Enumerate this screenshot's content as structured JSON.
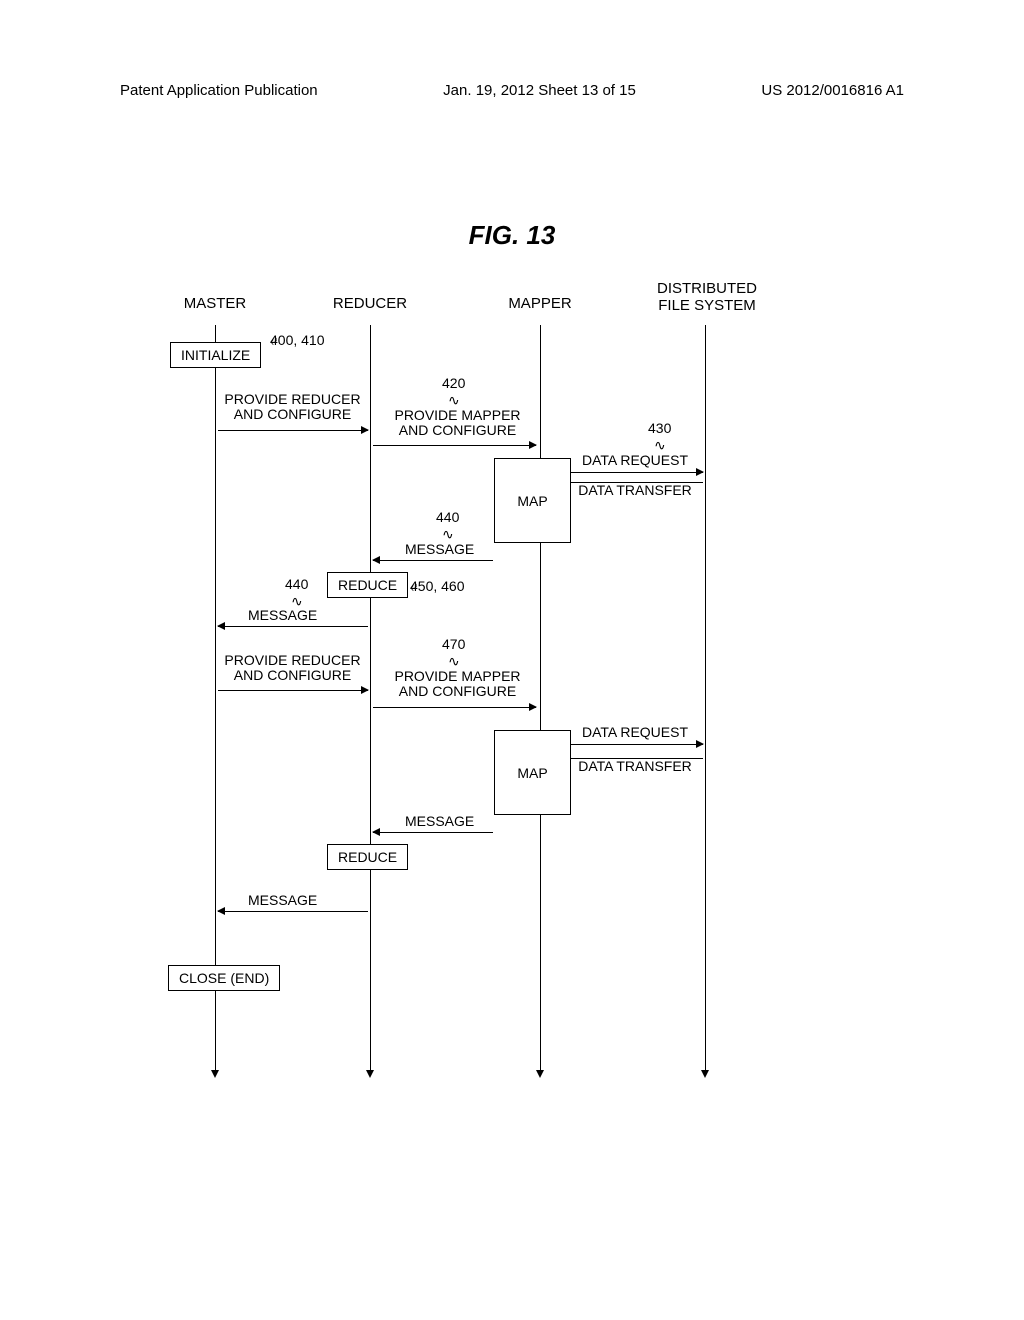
{
  "header": {
    "left": "Patent Application Publication",
    "center": "Jan. 19, 2012  Sheet 13 of 15",
    "right": "US 2012/0016816 A1"
  },
  "figure_title": "FIG.  13",
  "lifelines": {
    "master": "MASTER",
    "reducer": "REDUCER",
    "mapper": "MAPPER",
    "dfs": "DISTRIBUTED\nFILE SYSTEM"
  },
  "boxes": {
    "initialize": "INITIALIZE",
    "map1": "MAP",
    "reduce1": "REDUCE",
    "map2": "MAP",
    "reduce2": "REDUCE",
    "close": "CLOSE (END)"
  },
  "messages": {
    "prov_reducer1": "PROVIDE REDUCER\nAND CONFIGURE",
    "prov_mapper1": "PROVIDE MAPPER\nAND CONFIGURE",
    "data_request1": "DATA REQUEST",
    "data_transfer1": "DATA TRANSFER",
    "message_r1": "MESSAGE",
    "message_m1": "MESSAGE",
    "prov_reducer2": "PROVIDE REDUCER\nAND CONFIGURE",
    "prov_mapper2": "PROVIDE MAPPER\nAND CONFIGURE",
    "data_request2": "DATA REQUEST",
    "data_transfer2": "DATA TRANSFER",
    "message_r2": "MESSAGE",
    "message_m2": "MESSAGE"
  },
  "refs": {
    "r400": "400, 410",
    "r420": "420",
    "r430": "430",
    "r440a": "440",
    "r440b": "440",
    "r450": "450, 460",
    "r470": "470"
  },
  "chart_data": {
    "type": "sequence_diagram",
    "participants": [
      "MASTER",
      "REDUCER",
      "MAPPER",
      "DISTRIBUTED FILE SYSTEM"
    ],
    "steps": [
      {
        "actor": "MASTER",
        "action": "INITIALIZE",
        "ref": "400, 410"
      },
      {
        "from": "MASTER",
        "to": "REDUCER",
        "label": "PROVIDE REDUCER AND CONFIGURE"
      },
      {
        "from": "REDUCER",
        "to": "MAPPER",
        "label": "PROVIDE MAPPER AND CONFIGURE",
        "ref": "420"
      },
      {
        "from": "MAPPER",
        "to": "DISTRIBUTED FILE SYSTEM",
        "label": "DATA REQUEST",
        "ref": "430"
      },
      {
        "from": "DISTRIBUTED FILE SYSTEM",
        "to": "MAPPER",
        "label": "DATA TRANSFER"
      },
      {
        "actor": "MAPPER",
        "action": "MAP"
      },
      {
        "from": "MAPPER",
        "to": "REDUCER",
        "label": "MESSAGE",
        "ref": "440"
      },
      {
        "actor": "REDUCER",
        "action": "REDUCE",
        "ref": "450, 460"
      },
      {
        "from": "REDUCER",
        "to": "MASTER",
        "label": "MESSAGE",
        "ref": "440"
      },
      {
        "from": "MASTER",
        "to": "REDUCER",
        "label": "PROVIDE REDUCER AND CONFIGURE"
      },
      {
        "from": "REDUCER",
        "to": "MAPPER",
        "label": "PROVIDE MAPPER AND CONFIGURE",
        "ref": "470"
      },
      {
        "from": "MAPPER",
        "to": "DISTRIBUTED FILE SYSTEM",
        "label": "DATA REQUEST"
      },
      {
        "from": "DISTRIBUTED FILE SYSTEM",
        "to": "MAPPER",
        "label": "DATA TRANSFER"
      },
      {
        "actor": "MAPPER",
        "action": "MAP"
      },
      {
        "from": "MAPPER",
        "to": "REDUCER",
        "label": "MESSAGE"
      },
      {
        "actor": "REDUCER",
        "action": "REDUCE"
      },
      {
        "from": "REDUCER",
        "to": "MASTER",
        "label": "MESSAGE"
      },
      {
        "actor": "MASTER",
        "action": "CLOSE (END)"
      }
    ]
  }
}
